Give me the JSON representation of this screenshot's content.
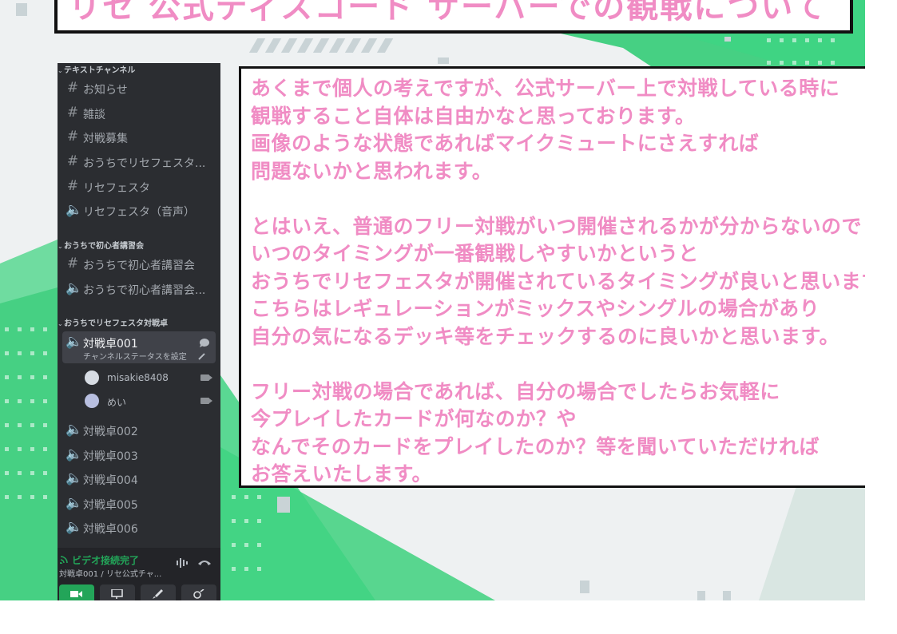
{
  "slide": {
    "title": "リセ 公式ディスコード サーバーでの観戦について",
    "note_lines": [
      "あくまで個人の考えですが、公式サーバー上で対戦している時に",
      "観戦すること自体は自由かなと思っております。",
      "画像のような状態であればマイクミュートにさえすれば",
      "問題ないかと思われます。",
      "",
      "とはいえ、普通のフリー対戦がいつ開催されるかが分からないので",
      "いつのタイミングが一番観戦しやすいかというと",
      "おうちでリセフェスタが開催されているタイミングが良いと思います",
      "こちらはレギュレーションがミックスやシングルの場合があり",
      "自分の気になるデッキ等をチェックするのに良いかと思います。",
      "",
      "フリー対戦の場合であれば、自分の場合でしたらお気軽に",
      "今プレイしたカードが何なのか？や",
      "なんでそのカードをプレイしたのか？等を聞いていただければ",
      "お答えいたします。"
    ],
    "colors": {
      "note_text": "#f08cc4",
      "accent_green": "#3fd483"
    }
  },
  "discord": {
    "categories": [
      {
        "label": "テキストチャンネル"
      },
      {
        "label": "おうちで初心者講習会"
      },
      {
        "label": "おうちでリセフェスタ対戦卓"
      }
    ],
    "channels": [
      {
        "icon": "hash-icon",
        "label": "お知らせ"
      },
      {
        "icon": "hash-icon",
        "label": "雑談"
      },
      {
        "icon": "hash-icon",
        "label": "対戦募集"
      },
      {
        "icon": "hash-icon",
        "label": "おうちでリセフェスタ..."
      },
      {
        "icon": "hash-icon",
        "label": "リセフェスタ"
      },
      {
        "icon": "speaker-icon",
        "label": "リセフェスタ（音声）"
      },
      {
        "icon": "hash-icon",
        "label": "おうちで初心者講習会"
      },
      {
        "icon": "speaker-icon",
        "label": "おうちで初心者講習会..."
      },
      {
        "icon": "speaker-icon",
        "label": "対戦卓001",
        "status": "チャンネルステータスを設定"
      },
      {
        "icon": "speaker-icon",
        "label": "対戦卓002"
      },
      {
        "icon": "speaker-icon",
        "label": "対戦卓003"
      },
      {
        "icon": "speaker-icon",
        "label": "対戦卓004"
      },
      {
        "icon": "speaker-icon",
        "label": "対戦卓005"
      },
      {
        "icon": "speaker-icon",
        "label": "対戦卓006"
      }
    ],
    "voice_users": [
      {
        "name": "misakie8408"
      },
      {
        "name": "めい"
      }
    ],
    "voice_panel": {
      "status": "ビデオ接続完了",
      "channel": "対戦卓001 / リセ公式チャ..."
    },
    "colors": {
      "bg": "#2b2d31",
      "panel": "#232428",
      "connected": "#23a559"
    }
  }
}
